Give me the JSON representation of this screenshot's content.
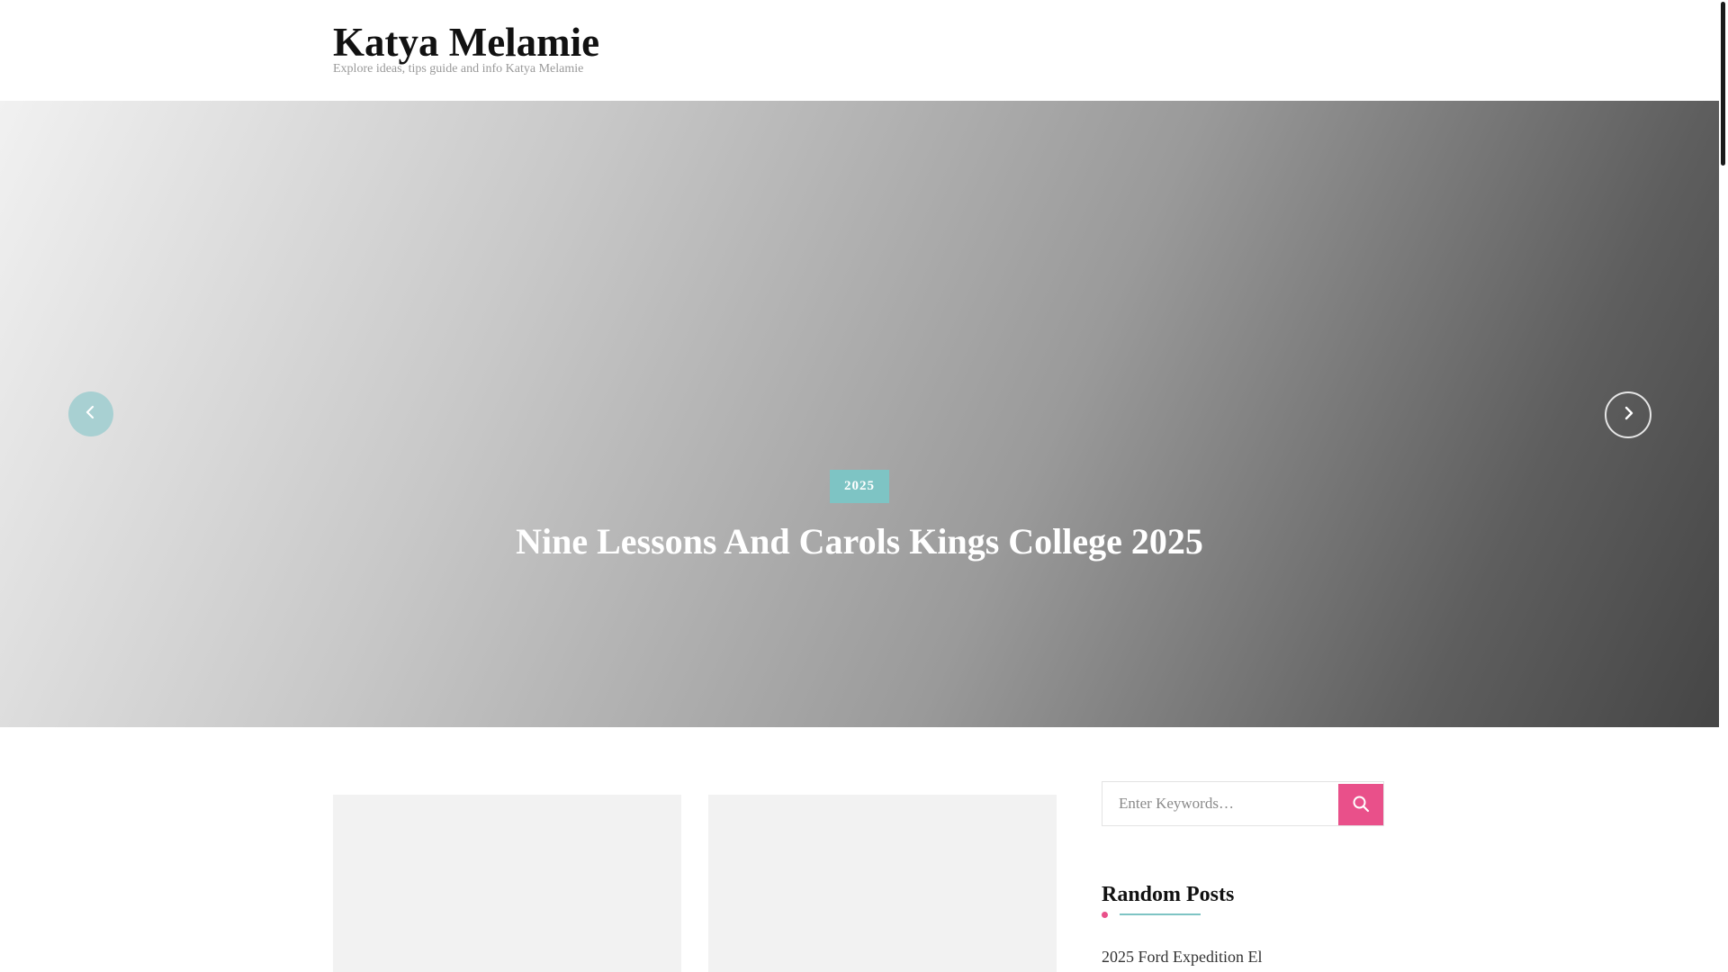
{
  "header": {
    "site_title": "Katya Melamie",
    "tagline": "Explore ideas, tips guide and info Katya Melamie"
  },
  "hero": {
    "badge": "2025",
    "title": "Nine Lessons And Carols Kings College 2025",
    "prev_icon": "chevron-left-icon",
    "next_icon": "chevron-right-icon"
  },
  "sidebar": {
    "search": {
      "placeholder": "Enter Keywords…",
      "value": "",
      "icon": "search-icon"
    },
    "random_posts": {
      "title": "Random Posts",
      "items": [
        "2025 Ford Expedition El"
      ]
    }
  },
  "colors": {
    "accent_pink": "#e9508a",
    "accent_teal": "#7ec4c4"
  }
}
